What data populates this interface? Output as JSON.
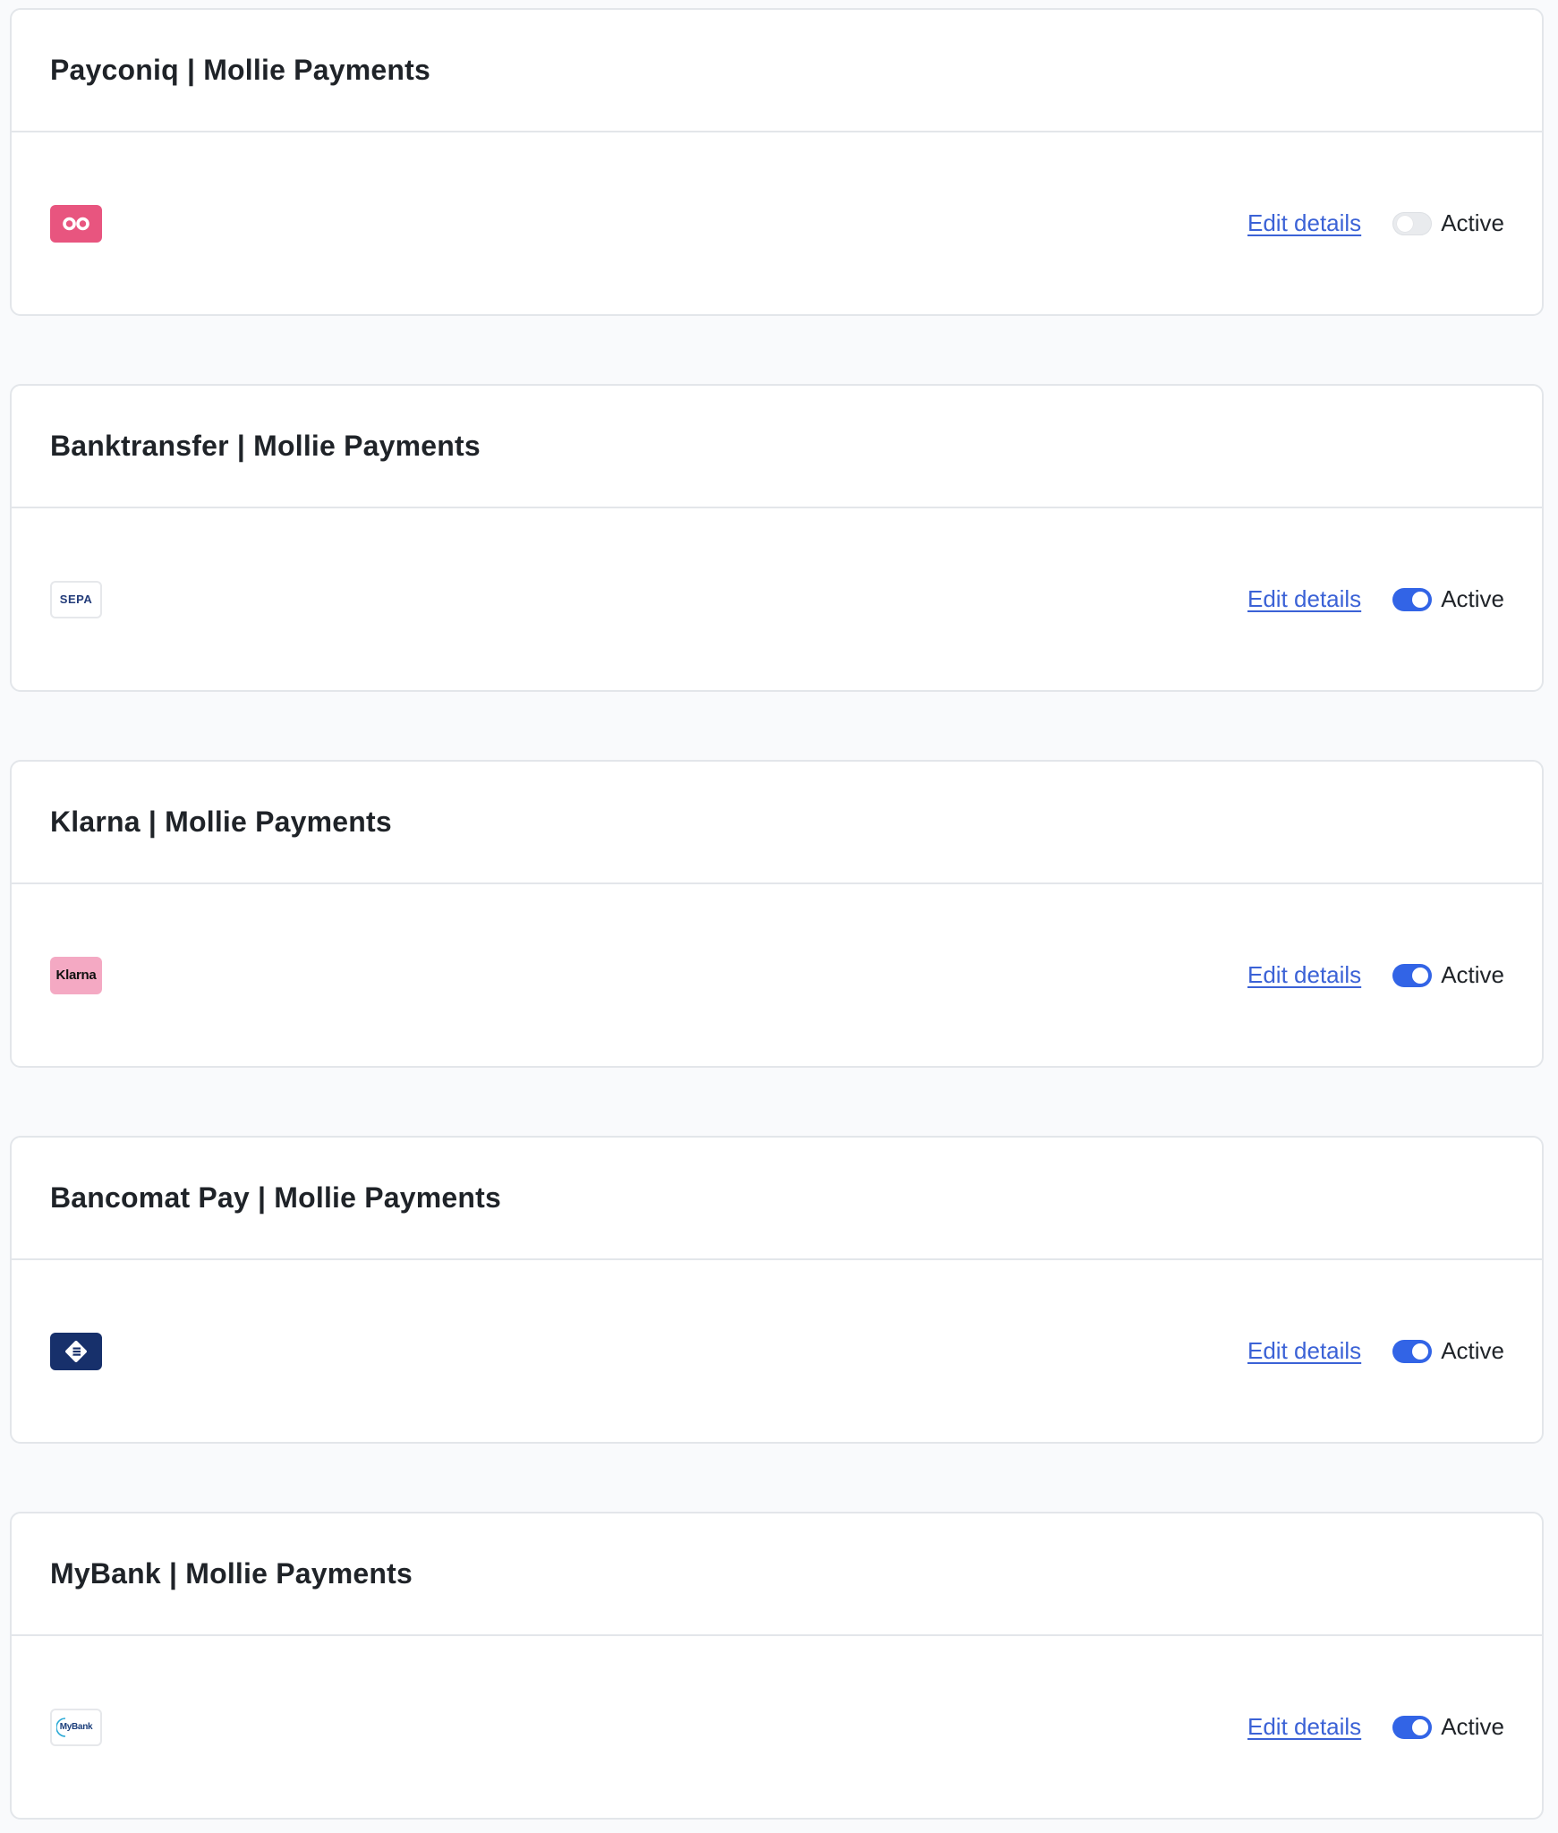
{
  "cards": [
    {
      "title": "Payconiq | Mollie Payments",
      "logo": "payconiq-logo",
      "edit_label": "Edit details",
      "toggle_label": "Active",
      "active": false
    },
    {
      "title": "Banktransfer | Mollie Payments",
      "logo": "sepa-logo",
      "logo_text": "SEPA",
      "edit_label": "Edit details",
      "toggle_label": "Active",
      "active": true
    },
    {
      "title": "Klarna | Mollie Payments",
      "logo": "klarna-logo",
      "logo_text": "Klarna",
      "edit_label": "Edit details",
      "toggle_label": "Active",
      "active": true
    },
    {
      "title": "Bancomat Pay | Mollie Payments",
      "logo": "bancomat-logo",
      "edit_label": "Edit details",
      "toggle_label": "Active",
      "active": true
    },
    {
      "title": "MyBank | Mollie Payments",
      "logo": "mybank-logo",
      "logo_text": "MyBank",
      "edit_label": "Edit details",
      "toggle_label": "Active",
      "active": true
    }
  ],
  "colors": {
    "link": "#3b62d6",
    "toggle_on": "#3264e6",
    "toggle_off": "#e9ebee",
    "payconiq": "#e8557f",
    "klarna": "#f4a9c3",
    "bancomat": "#17306b"
  }
}
